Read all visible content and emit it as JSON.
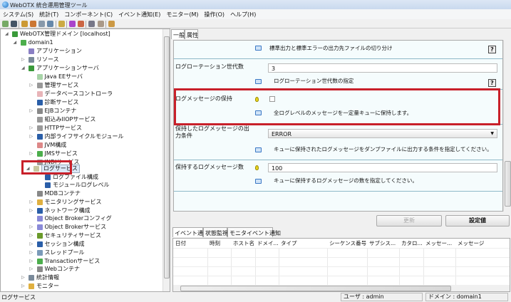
{
  "window": {
    "title": "WebOTX 統合運用管理ツール"
  },
  "menu": [
    "システム(S)",
    "統計(T)",
    "コンポーネント(C)",
    "イベント通知(E)",
    "モニター(M)",
    "操作(O)",
    "ヘルプ(H)"
  ],
  "tree": {
    "items": [
      {
        "label": "WebOTX管理ドメイン [localhost]",
        "level": 0,
        "arrow": "◢",
        "color": "#3a9a3a"
      },
      {
        "label": "domain1",
        "level": 1,
        "arrow": "◢",
        "color": "#4cae4c"
      },
      {
        "label": "アプリケーション",
        "level": 2,
        "arrow": "",
        "color": "#8a7fc4"
      },
      {
        "label": "リソース",
        "level": 2,
        "arrow": "▷",
        "color": "#7a8a9a"
      },
      {
        "label": "アプリケーションサーバ",
        "level": 2,
        "arrow": "◢",
        "color": "#3a9a3a"
      },
      {
        "label": "Java EEサーバ",
        "level": 3,
        "arrow": "",
        "color": "#a8d4a8"
      },
      {
        "label": "管理サービス",
        "level": 3,
        "arrow": "▷",
        "color": "#999"
      },
      {
        "label": "データベースコントローラ",
        "level": 3,
        "arrow": "",
        "color": "#e8b4b8"
      },
      {
        "label": "診断サービス",
        "level": 3,
        "arrow": "",
        "color": "#2a5ea8"
      },
      {
        "label": "EJBコンテナ",
        "level": 3,
        "arrow": "▷",
        "color": "#888"
      },
      {
        "label": "組込みIIOPサービス",
        "level": 3,
        "arrow": "",
        "color": "#999"
      },
      {
        "label": "HTTPサービス",
        "level": 3,
        "arrow": "▷",
        "color": "#999"
      },
      {
        "label": "内部ライフサイクルモジュール",
        "level": 3,
        "arrow": "▷",
        "color": "#2a5ea8"
      },
      {
        "label": "JVM構成",
        "level": 3,
        "arrow": "",
        "color": "#d88"
      },
      {
        "label": "JMSサービス",
        "level": 3,
        "arrow": "▷",
        "color": "#4cae4c"
      },
      {
        "label": "JNDIサービス",
        "level": 3,
        "arrow": "",
        "color": "#999"
      },
      {
        "label": "ログサービス",
        "level": 2.6,
        "arrow": "◢",
        "color": "#c8c8a0",
        "selected": true
      },
      {
        "label": "ログファイル構成",
        "level": 4,
        "arrow": "",
        "color": "#2a5ea8"
      },
      {
        "label": "モジュールログレベル",
        "level": 4,
        "arrow": "",
        "color": "#2a5ea8"
      },
      {
        "label": "MDBコンテナ",
        "level": 3,
        "arrow": "",
        "color": "#888"
      },
      {
        "label": "モニタリングサービス",
        "level": 3,
        "arrow": "▷",
        "color": "#e0b040"
      },
      {
        "label": "ネットワーク構成",
        "level": 3,
        "arrow": "▷",
        "color": "#2a5ea8"
      },
      {
        "label": "Object Brokerコンフィグ",
        "level": 3,
        "arrow": "",
        "color": "#8a8ad8"
      },
      {
        "label": "Object Brokerサービス",
        "level": 3,
        "arrow": "▷",
        "color": "#8a8ad8"
      },
      {
        "label": "セキュリティサービス",
        "level": 3,
        "arrow": "▷",
        "color": "#6a9a2a"
      },
      {
        "label": "セッション構成",
        "level": 3,
        "arrow": "▷",
        "color": "#2a5ea8"
      },
      {
        "label": "スレッドプール",
        "level": 3,
        "arrow": "▷",
        "color": "#7a9ab8"
      },
      {
        "label": "Transactionサービス",
        "level": 3,
        "arrow": "▷",
        "color": "#4cae4c"
      },
      {
        "label": "Webコンテナ",
        "level": 3,
        "arrow": "▷",
        "color": "#888"
      },
      {
        "label": "統計情報",
        "level": 2,
        "arrow": "▷",
        "color": "#7a8a9a"
      },
      {
        "label": "モニター",
        "level": 2,
        "arrow": "▷",
        "color": "#e0b040"
      }
    ]
  },
  "tabs_top": [
    "一般",
    "属性"
  ],
  "props": {
    "row0_desc": "標準出力と標準エラーの出力先ファイルの切り分け",
    "help": "?",
    "rotation_label": "ログローテーション世代数",
    "rotation_value": "3",
    "rotation_desc": "ログローテーション世代数の指定",
    "keep_label": "ログメッセージの保持",
    "keep_checked": false,
    "keep_desc": "全ログレベルのメッセージを一定量キューに保持します。",
    "cond_label": "保持したログメッセージの出力条件",
    "cond_value": "ERROR",
    "cond_desc": "キューに保持されたログメッセージをダンプファイルに出力する条件を指定してください。",
    "count_label": "保持するログメッセージ数",
    "count_value": "100",
    "count_desc": "キューに保持するログメッセージの数を指定してください。"
  },
  "buttons": {
    "update": "更新",
    "settings": "設定値"
  },
  "tabs_bottom": [
    "イベント通知",
    "状態監視",
    "モニタイベント通知"
  ],
  "table": {
    "columns": [
      "日付",
      "時刻",
      "ホスト名",
      "ドメイ...",
      "タイプ",
      "シーケンス番号",
      "サブシス...",
      "カタロ...",
      "メッセー...",
      "メッセージ"
    ]
  },
  "status": {
    "left": "ログサービス",
    "user": "ユーザ : admin",
    "domain": "ドメイン : domain1"
  },
  "colors": {
    "highlight": "#c8202a",
    "panel": "#f5fcfd"
  }
}
